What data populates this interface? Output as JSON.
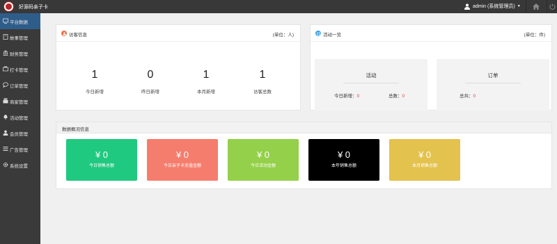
{
  "topbar": {
    "brand": "好源码亲子卡",
    "user": "admin (系统管理员)",
    "colors": {
      "background": "#383838",
      "logo": "#b3262b"
    },
    "icons": {
      "logo": "logo-icon",
      "user": "user-icon",
      "home": "home-icon",
      "power": "power-icon"
    }
  },
  "sidebar": {
    "items": [
      {
        "label": "平台数据",
        "icon": "monitor-icon",
        "active": true
      },
      {
        "label": "故事管理",
        "icon": "book-icon"
      },
      {
        "label": "财务管理",
        "icon": "finance-icon"
      },
      {
        "label": "打卡管理",
        "icon": "checkin-icon"
      },
      {
        "label": "订单管理",
        "icon": "chat-icon"
      },
      {
        "label": "商家管理",
        "icon": "store-icon"
      },
      {
        "label": "活动管理",
        "icon": "bell-icon"
      },
      {
        "label": "会员管理",
        "icon": "user-icon"
      },
      {
        "label": "广告管理",
        "icon": "list-icon"
      },
      {
        "label": "系统设置",
        "icon": "gear-icon"
      }
    ],
    "active_color": "#2f5d8a"
  },
  "visitor": {
    "title": "访客信息",
    "unit": "(单位：人)",
    "stats": [
      {
        "value": "1",
        "label": "今日新增"
      },
      {
        "value": "0",
        "label": "昨日新增"
      },
      {
        "value": "1",
        "label": "本月新增"
      },
      {
        "value": "1",
        "label": "访客总数"
      }
    ],
    "icon_color": "#e8744a"
  },
  "activity": {
    "title": "活动一览",
    "unit": "(单位：件)",
    "icon_color": "#3ba1e0",
    "boxes": [
      {
        "title": "活动",
        "items": [
          {
            "label": "今日新增：",
            "value": "0"
          },
          {
            "label": "总数：",
            "value": "0"
          }
        ]
      },
      {
        "title": "订单",
        "items": [
          {
            "label": "总共：",
            "value": "0"
          }
        ]
      }
    ]
  },
  "summary": {
    "title": "数据概况信息",
    "cards": [
      {
        "value": "¥ 0",
        "label": "今日销售总额",
        "color": "#1fc97f"
      },
      {
        "value": "¥ 0",
        "label": "今日亲子卡充值金额",
        "color": "#f57d6d"
      },
      {
        "value": "¥ 0",
        "label": "今日活动金额",
        "color": "#94d04a"
      },
      {
        "value": "¥ 0",
        "label": "本年销售总额",
        "color": "#000000"
      },
      {
        "value": "¥ 0",
        "label": "本月销售总额",
        "color": "#e3c24e"
      }
    ]
  }
}
